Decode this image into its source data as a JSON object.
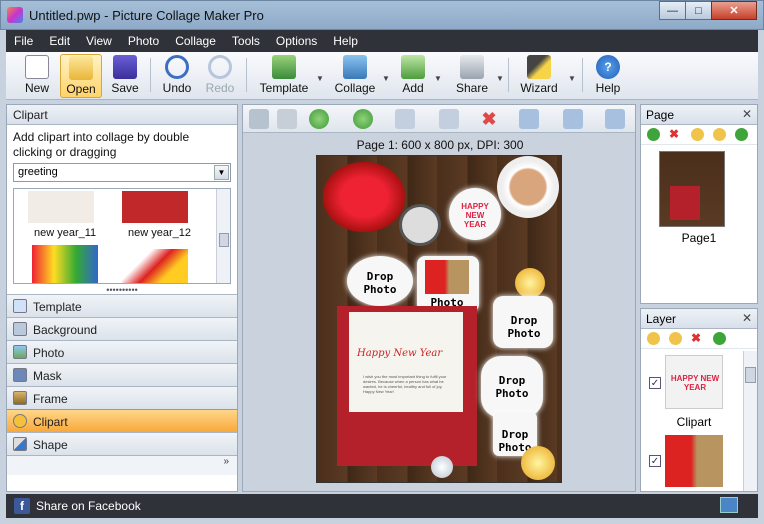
{
  "window": {
    "title": "Untitled.pwp - Picture Collage Maker Pro"
  },
  "menu": [
    "File",
    "Edit",
    "View",
    "Photo",
    "Collage",
    "Tools",
    "Options",
    "Help"
  ],
  "toolbar": {
    "new": "New",
    "open": "Open",
    "save": "Save",
    "undo": "Undo",
    "redo": "Redo",
    "template": "Template",
    "collage": "Collage",
    "add": "Add",
    "share": "Share",
    "wizard": "Wizard",
    "help": "Help"
  },
  "clipart": {
    "header": "Clipart",
    "description": "Add clipart into collage by double clicking or dragging",
    "category": "greeting",
    "items": [
      "new year_11",
      "new year_12"
    ]
  },
  "sections": [
    "Template",
    "Background",
    "Photo",
    "Mask",
    "Frame",
    "Clipart",
    "Shape"
  ],
  "active_section": "Clipart",
  "canvas": {
    "page_info": "Page 1: 600 x 800 px, DPI: 300",
    "drop_label_top": "Drop",
    "drop_label_bottom": "Photo",
    "photo_label": "Photo",
    "card_title": "Happy New Year",
    "card_text": "I wish you the most important thing to fulfil your desires. Because when a person has what he wanted, he is cheerful, healthy and full of joy. Happy New Year!",
    "badge_text": "HAPPY NEW YEAR"
  },
  "page_panel": {
    "header": "Page",
    "page_label": "Page1"
  },
  "layer_panel": {
    "header": "Layer",
    "layer_label": "Clipart"
  },
  "status": {
    "share_facebook": "Share on Facebook"
  }
}
